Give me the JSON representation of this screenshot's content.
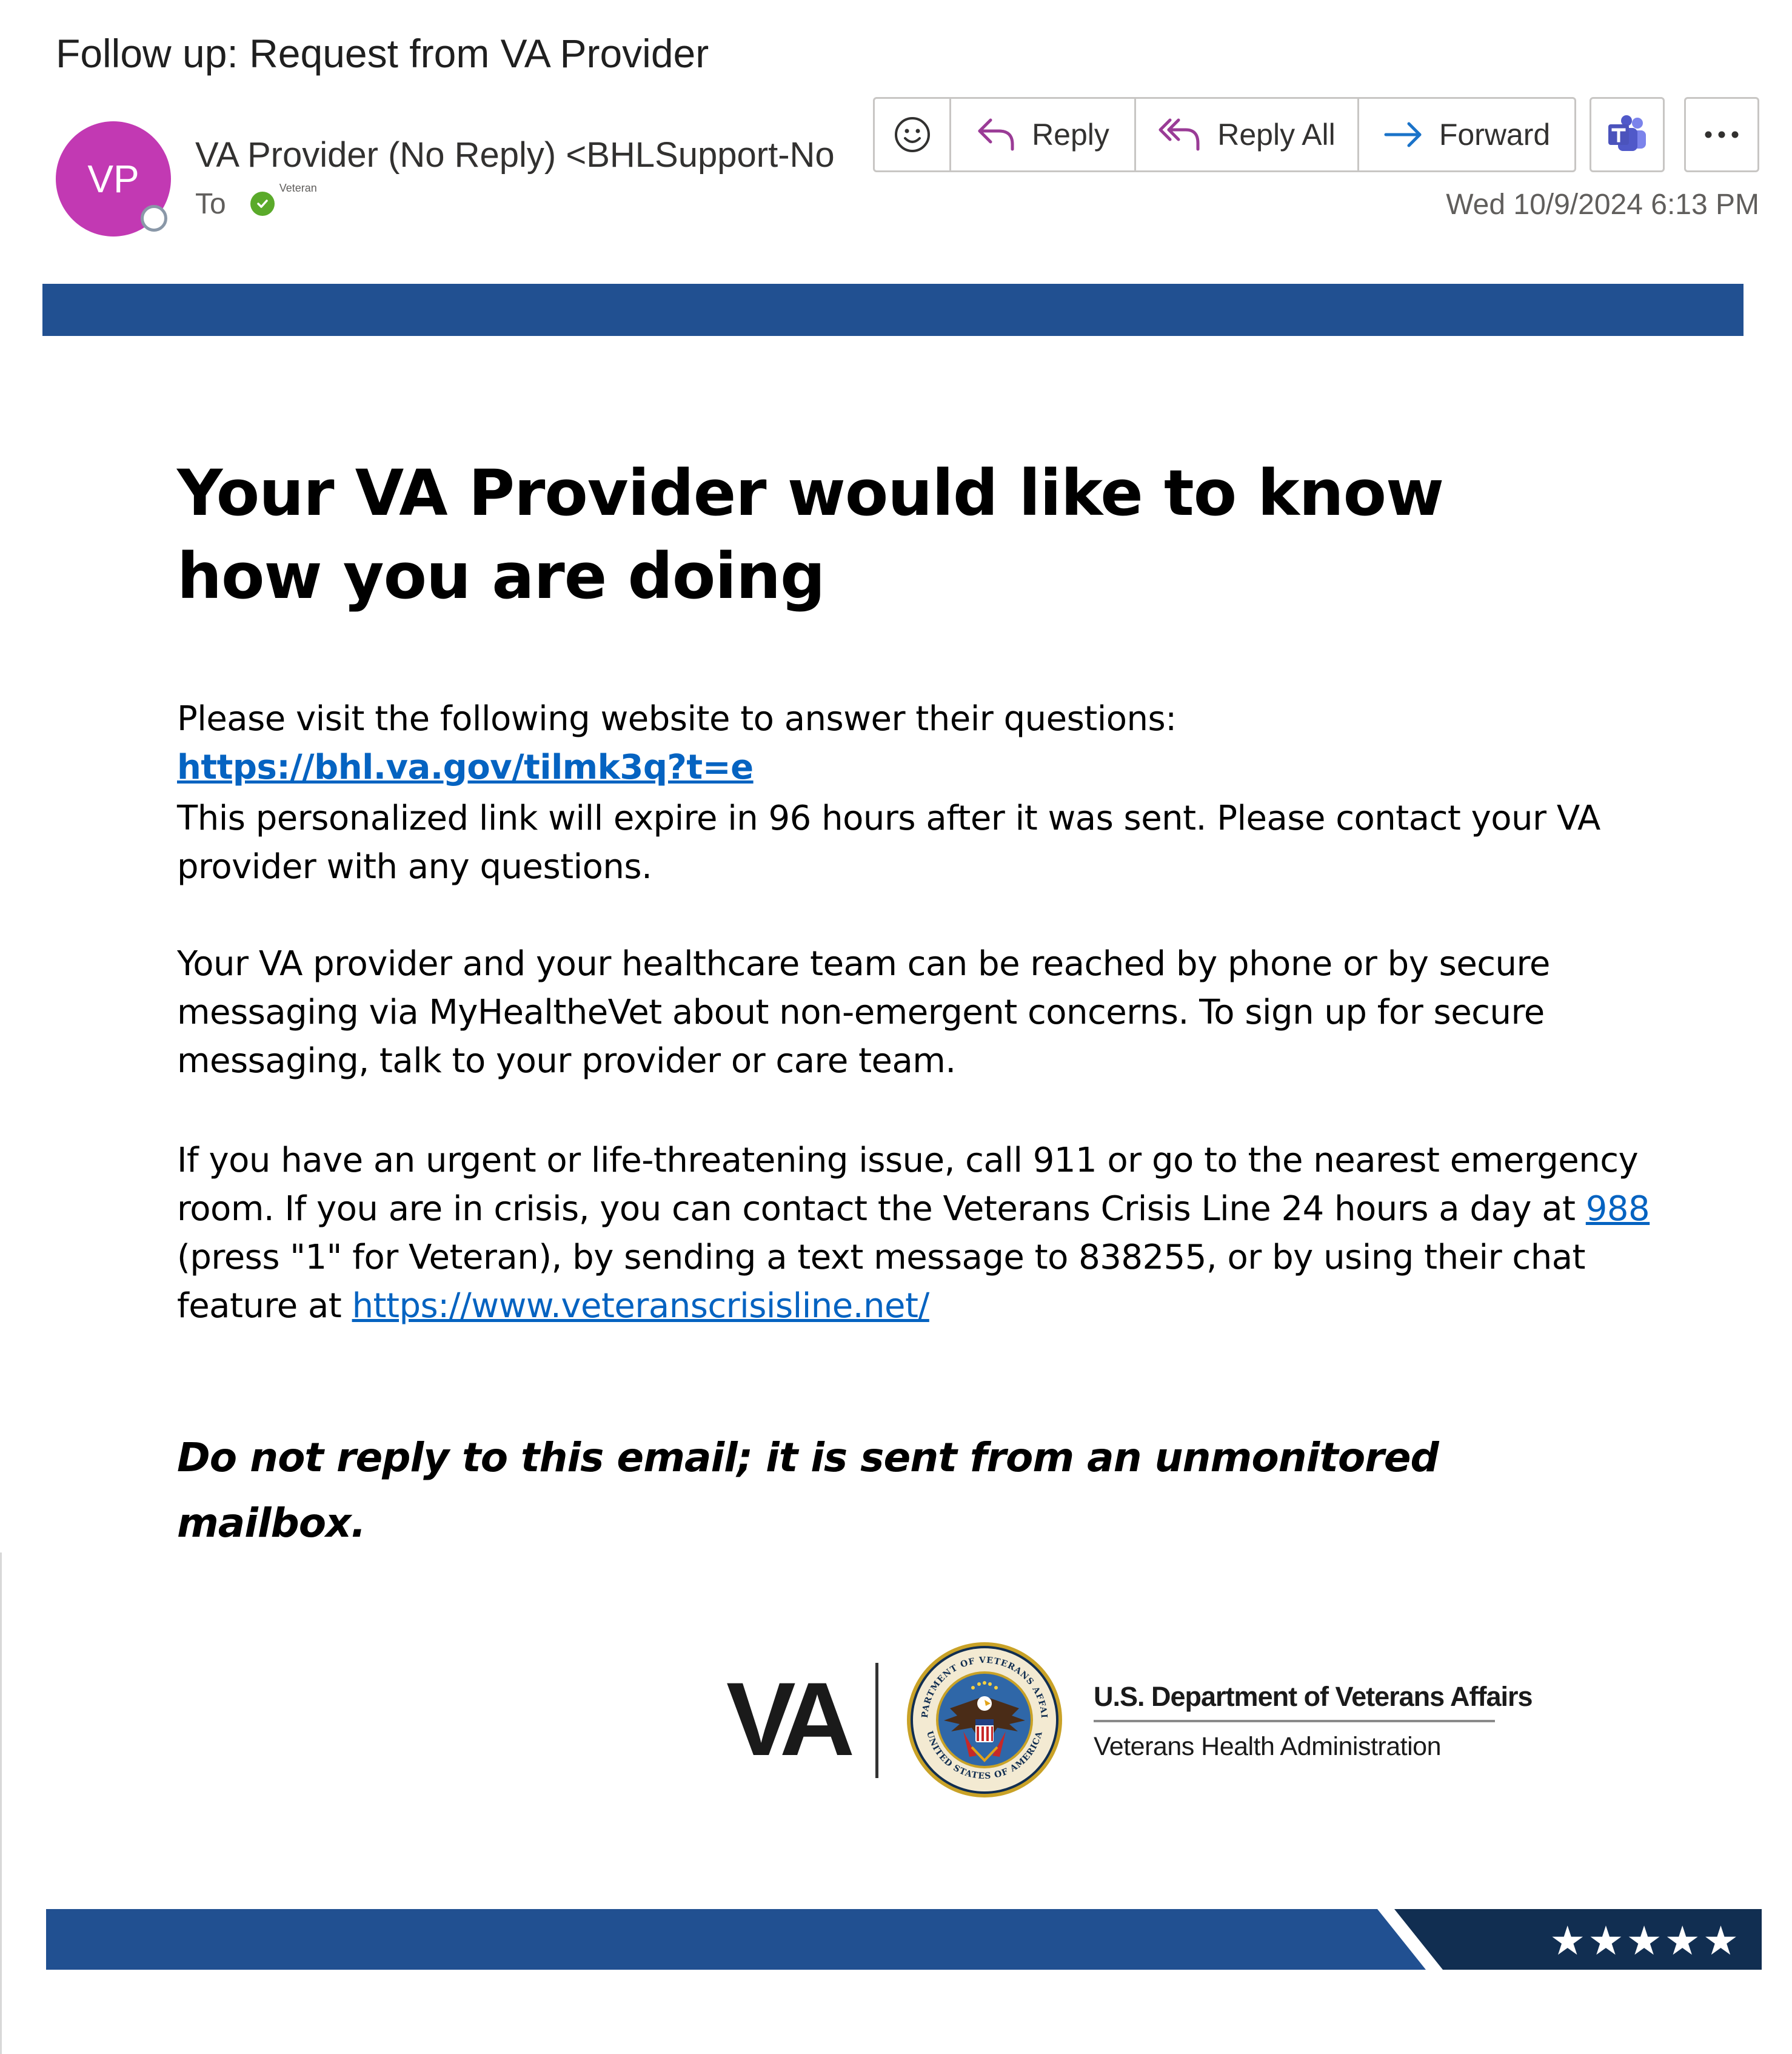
{
  "header": {
    "subject": "Follow up: Request from VA Provider",
    "avatar_initials": "VP",
    "sender": "VA Provider (No Reply) <BHLSupport-No",
    "to_label": "To",
    "recipient": "Veteran",
    "date": "Wed 10/9/2024 6:13 PM"
  },
  "toolbar": {
    "reply_label": "Reply",
    "reply_all_label": "Reply All",
    "forward_label": "Forward",
    "icons": [
      "emoji-icon",
      "reply-icon",
      "reply-all-icon",
      "forward-icon",
      "teams-icon",
      "more-icon"
    ]
  },
  "email": {
    "title": "Your VA Provider would like to know how you are doing",
    "p1_text": "Please visit the following website to answer their questions: ",
    "p1_link": "https://bhl.va.gov/tilmk3q?t=e",
    "p2": "This personalized link will expire in 96 hours after it was sent. Please contact your VA provider with any questions.",
    "p3": "Your VA provider and your healthcare team can be reached by phone or by secure messaging via MyHealtheVet about non-emergent concerns. To sign up for secure messaging, talk to your provider or care team.",
    "p4_a": "If you have an urgent or life-threatening issue, call 911 or go to the nearest emergency room. If you are in crisis, you can contact the Veterans Crisis Line 24 hours a day at ",
    "p4_link_988": "988",
    "p4_b": " (press \"1\" for Veteran), by sending a text message to 838255, or by using their chat feature at ",
    "p4_link_crisis": "https://www.veteranscrisisline.net/",
    "notice": "Do not reply to this email; it is sent from an unmonitored mailbox."
  },
  "logo": {
    "mark": "VA",
    "department": "U.S. Department of Veterans Affairs",
    "administration": "Veterans Health Administration",
    "seal_top_text": "DEPARTMENT OF VETERANS AFFAIRS",
    "seal_bottom_text": "UNITED STATES OF AMERICA"
  },
  "footer": {
    "stars": "★★★★★"
  },
  "colors": {
    "brand_blue": "#215091",
    "navy": "#112e51",
    "link": "#0563c1",
    "avatar": "#c239b3"
  }
}
